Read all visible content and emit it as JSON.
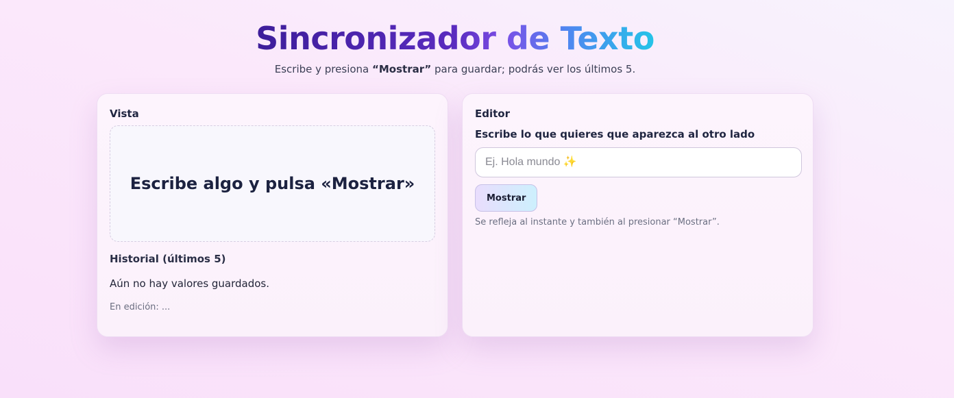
{
  "header": {
    "title": "Sincronizador de Texto",
    "subtitle_pre": "Escribe y presiona ",
    "subtitle_bold": "“Mostrar”",
    "subtitle_post": " para guardar; podrás ver los últimos 5."
  },
  "view_panel": {
    "label": "Vista",
    "preview_text": "Escribe algo y pulsa «Mostrar»",
    "history_title": "Historial (últimos 5)",
    "history_empty": "Aún no hay valores guardados.",
    "editing_status": "En edición: ..."
  },
  "editor_panel": {
    "label": "Editor",
    "field_label": "Escribe lo que quieres que aparezca al otro lado",
    "input_placeholder": "Ej. Hola mundo ✨",
    "input_value": "",
    "button_label": "Mostrar",
    "hint": "Se refleja al instante y también al presionar “Mostrar”."
  },
  "colors": {
    "title_gradient_start": "#3d1e9a",
    "title_gradient_end": "#25c4e8",
    "button_gradient_start": "#e9ddfd",
    "button_gradient_end": "#cdf0fd"
  }
}
